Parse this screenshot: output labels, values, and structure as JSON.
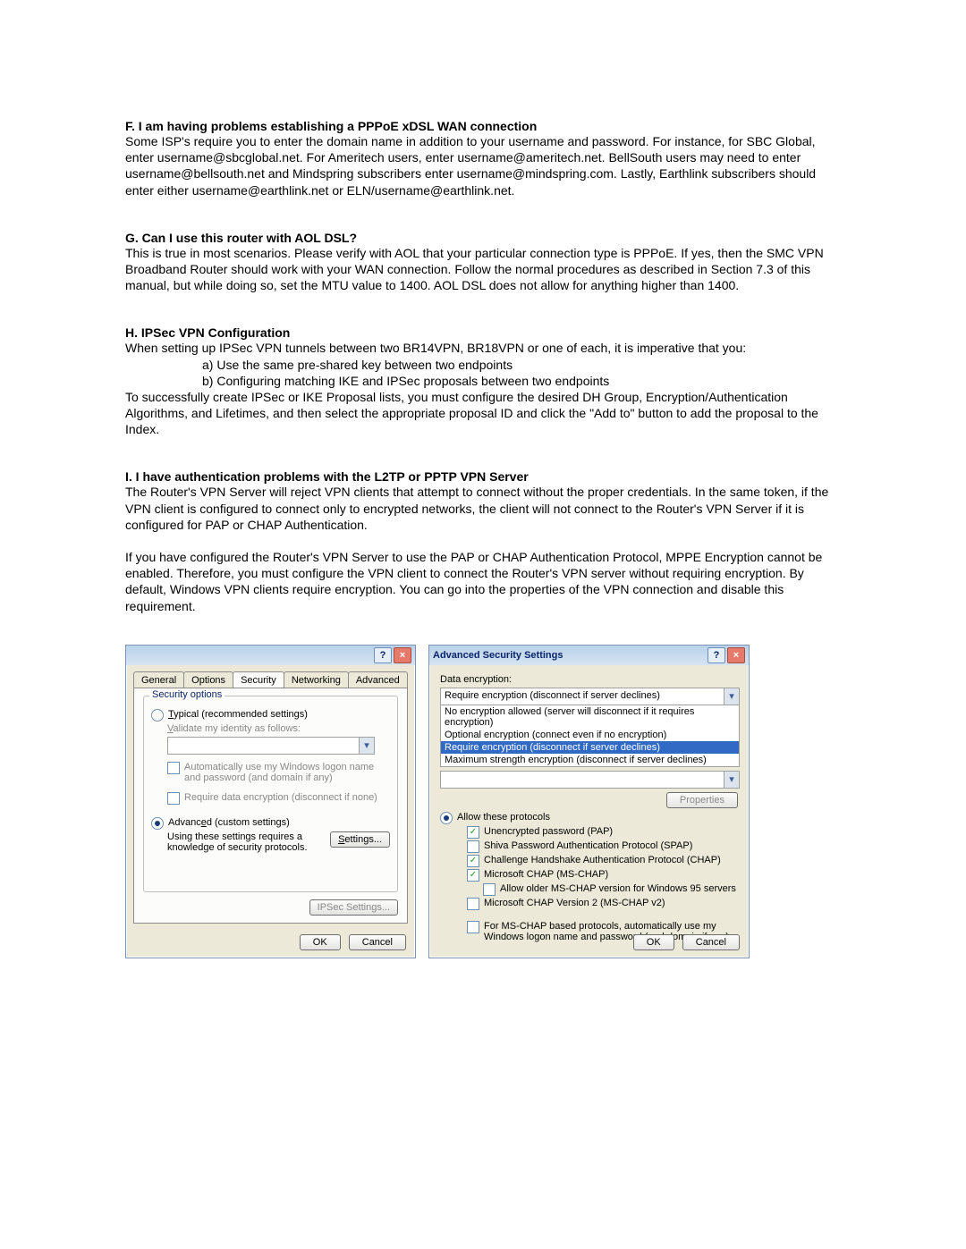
{
  "sections": {
    "f": {
      "title": "F. I am having problems establishing a PPPoE xDSL WAN connection",
      "body": "Some ISP's require you to enter the domain name in addition to your username and password. For instance, for SBC Global, enter username@sbcglobal.net. For Ameritech users, enter username@ameritech.net. BellSouth users may need to enter username@bellsouth.net and Mindspring subscribers enter username@mindspring.com. Lastly, Earthlink subscribers should enter either username@earthlink.net or ELN/username@earthlink.net."
    },
    "g": {
      "title": "G. Can I use this router with AOL DSL?",
      "body": "This is true in most scenarios. Please verify with AOL that your particular connection type is PPPoE. If yes, then the SMC VPN Broadband Router should work with your WAN connection. Follow the normal procedures as described in Section 7.3 of this manual, but while doing so, set the MTU value to 1400. AOL DSL does not allow for anything higher than 1400."
    },
    "h": {
      "title": "H. IPSec VPN Configuration",
      "intro": "When setting up IPSec VPN tunnels between two BR14VPN, BR18VPN or one of each, it is imperative that you:",
      "a": "a)  Use the same pre-shared key between two endpoints",
      "b": "b)  Configuring matching IKE and IPSec proposals between two endpoints",
      "after": "To successfully create IPSec or IKE Proposal lists, you must configure the desired DH Group, Encryption/Authentication Algorithms, and Lifetimes, and then select the appropriate proposal ID and click the \"Add to\" button to add the proposal to the Index."
    },
    "i": {
      "title": "I. I have authentication problems with the L2TP or PPTP VPN Server",
      "p1": "The Router's VPN Server will reject VPN clients that attempt to connect without the proper credentials. In the same token, if the VPN client is configured to connect only to encrypted networks, the client will not connect to the Router's VPN Server if it is configured for PAP or CHAP Authentication.",
      "p2": "If you have configured the Router's VPN Server to use the PAP or CHAP Authentication Protocol, MPPE Encryption cannot be enabled. Therefore, you must configure the VPN client to connect the Router's VPN server without requiring encryption. By default, Windows VPN clients require encryption. You can go into the properties of the VPN connection and disable this requirement."
    }
  },
  "dialog1": {
    "title": "",
    "tabs": [
      "General",
      "Options",
      "Security",
      "Networking",
      "Advanced"
    ],
    "group_legend": "Security options",
    "opt_typical": "Typical (recommended settings)",
    "validate_label": "Validate my identity as follows:",
    "auto_logon": "Automatically use my Windows logon name and password (and domain if any)",
    "require_enc": "Require data encryption (disconnect if none)",
    "opt_advanced": "Advanced (custom settings)",
    "adv_note": "Using these settings requires a knowledge of security protocols.",
    "settings_btn": "Settings...",
    "ipsec_btn": "IPSec Settings...",
    "ok": "OK",
    "cancel": "Cancel"
  },
  "dialog2": {
    "title": "Advanced Security Settings",
    "enc_label": "Data encryption:",
    "enc_value": "Require encryption (disconnect if server declines)",
    "enc_options": [
      "No encryption allowed (server will disconnect if it requires encryption)",
      "Optional encryption (connect even if no encryption)",
      "Require encryption (disconnect if server declines)",
      "Maximum strength encryption (disconnect if server declines)"
    ],
    "properties_btn": "Properties",
    "allow_label": "Allow these protocols",
    "pap": "Unencrypted password (PAP)",
    "spap": "Shiva Password Authentication Protocol (SPAP)",
    "chap": "Challenge Handshake Authentication Protocol (CHAP)",
    "mschap": "Microsoft CHAP (MS-CHAP)",
    "mschap_old": "Allow older MS-CHAP version for Windows 95 servers",
    "mschap2": "Microsoft CHAP Version 2 (MS-CHAP v2)",
    "auto_ms": "For MS-CHAP based protocols, automatically use my Windows logon name and password (and domain if any)",
    "ok": "OK",
    "cancel": "Cancel"
  }
}
